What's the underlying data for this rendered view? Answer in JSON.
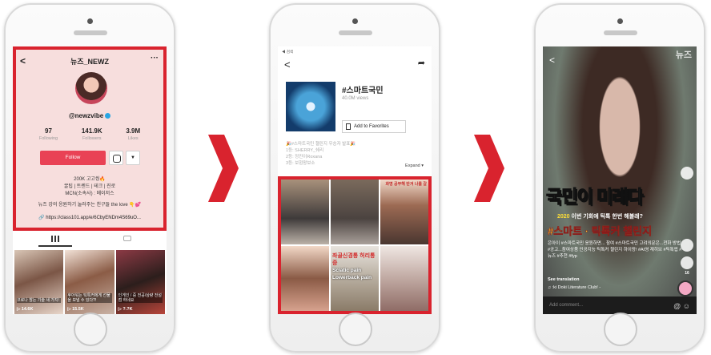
{
  "accent": "#d9232e",
  "phone1": {
    "profile": {
      "back_icon": "back-arrow-icon",
      "title": "뉴즈_NEWZ",
      "more_icon": "more-dots-icon",
      "handle": "@newzvibe",
      "stats": [
        {
          "value": "97",
          "label": "Following"
        },
        {
          "value": "141.9K",
          "label": "Followers"
        },
        {
          "value": "3.9M",
          "label": "Likes"
        }
      ],
      "follow_label": "Follow",
      "dropdown_label": "▼",
      "bio": [
        "200K 고고씽🔥",
        "꿀팁 | 트렌드 | 테크 | 진로",
        "MCN(소속사) : 메이저스",
        "뉴즈 강의 응원하기 눌러주는 친구들 the love 👇💕"
      ],
      "link": "https://class101.app/e/6CbyENDm4S69uO..."
    },
    "videos": [
      {
        "caption": "코로나 찮는 기술 새 가지!",
        "plays": "14.6K"
      },
      {
        "caption": "후아워는 틱톡커에게 선물을 보낼 수 있다?!",
        "plays": "15.5K"
      },
      {
        "caption": "인게인 / 중 전공/상량 전설점 하네요",
        "plays": "?.?K"
      }
    ]
  },
  "phone2": {
    "status": "◀ 검색",
    "hashtag": "#스마트국민",
    "views": "40.0M views",
    "favorites_label": "Add to Favorites",
    "description": [
      "🎉#스마트국민 챌린지 우승자 발표🎉",
      "1등: SHERRY_쉐리",
      "2등: 정진이Roxana",
      "3등: 보험왕보소"
    ],
    "expand_label": "Expand ▾",
    "grid_texts": {
      "cell3": "화명 공부해 반겨 나를 갈",
      "cell5_ko": "좌골신경통 허리통증",
      "cell5_en": "Sciatic pain Lowerback pain"
    }
  },
  "phone3": {
    "logo": "뉴즈",
    "headline": "국민이 미래다",
    "sub_year": "2020",
    "sub_text": " 이번 기회에 틱톡 한번 해볼래?",
    "challenge": "#스마트 · 틱톡커 챌린지",
    "description": "은아이 #스마트국민 응원하면... 참여 #스마트국민 고려의문은...전화 방법 #공고...참여상품 인공지능 틱톡커 챌린지 하이랑! #AI영 재히브 #틱톡앱 #뉴즈 #추천 #fyp",
    "translation_label": "See translation",
    "music": "♫  :ki Doki Literature Club! -",
    "comment_placeholder": "Add comment...",
    "side_counts": [
      "",
      "",
      "16"
    ]
  }
}
